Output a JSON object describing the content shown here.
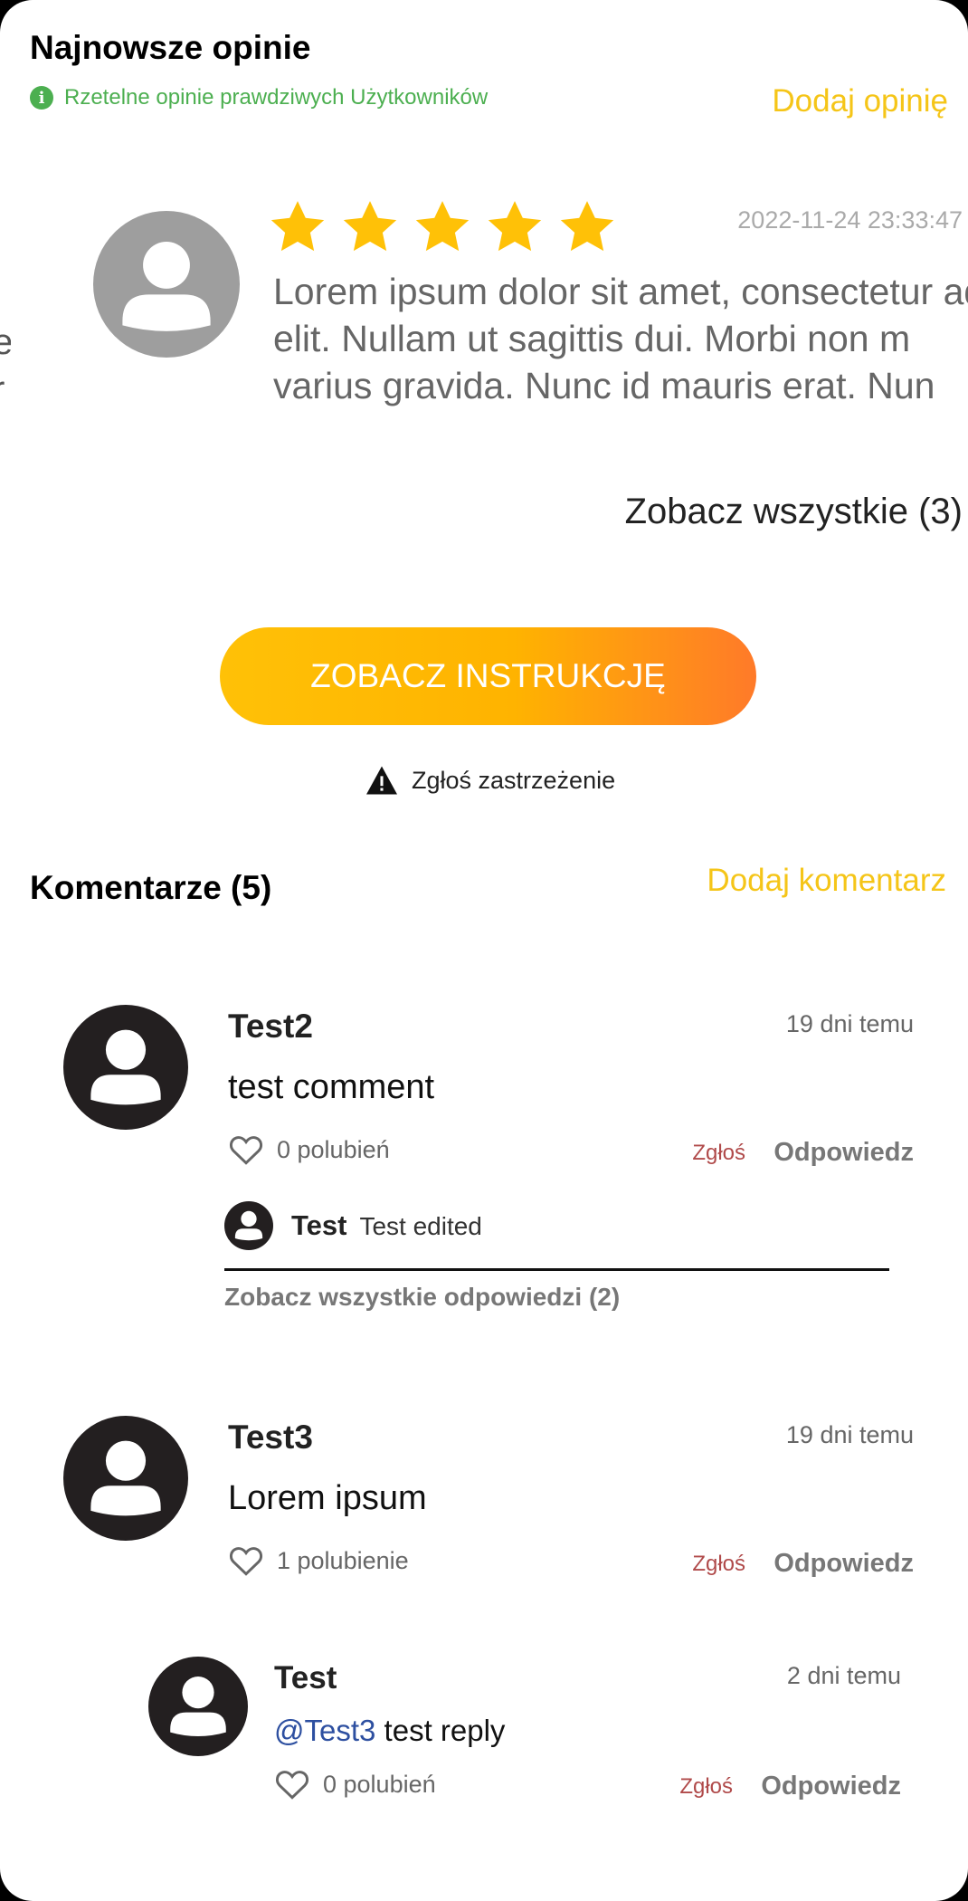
{
  "reviews": {
    "title": "Najnowsze opinie",
    "verified_text": "Rzetelne opinie prawdziwych Użytkowników",
    "verified_icon": "info-icon",
    "add_review": "Dodaj opinię",
    "item": {
      "rating": 5,
      "date": "2022-11-24 23:33:47",
      "text": "Lorem ipsum dolor sit amet, consectetur adipiscing\nelit. Nullam ut sagittis dui. Morbi non m\nvarius gravida. Nunc id mauris erat. Nun"
    },
    "see_all": "Zobacz wszystkie (3)"
  },
  "instructions_button": "ZOBACZ INSTRUKCJĘ",
  "report_claim": "Zgłoś zastrzeżenie",
  "comments": {
    "title": "Komentarze (5)",
    "add_comment": "Dodaj komentarz",
    "items": [
      {
        "author": "Test2",
        "time": "19 dni temu",
        "text": "test comment",
        "likes": "0 polubień",
        "report": "Zgłoś",
        "reply": "Odpowiedz",
        "preview_reply": {
          "author": "Test",
          "text": "Test edited"
        },
        "see_replies": "Zobacz wszystkie odpowiedzi (2)"
      },
      {
        "author": "Test3",
        "time": "19 dni temu",
        "text": "Lorem ipsum",
        "likes": "1 polubienie",
        "report": "Zgłoś",
        "reply": "Odpowiedz",
        "reply_item": {
          "author": "Test",
          "time": "2 dni temu",
          "mention": "@Test3",
          "text": " test reply",
          "likes": "0 polubień",
          "report": "Zgłoś",
          "reply": "Odpowiedz"
        }
      }
    ]
  },
  "colors": {
    "accent": "#f5c518",
    "verified": "#4caf50",
    "report": "#b04a4a",
    "mention": "#2d4fa0"
  }
}
